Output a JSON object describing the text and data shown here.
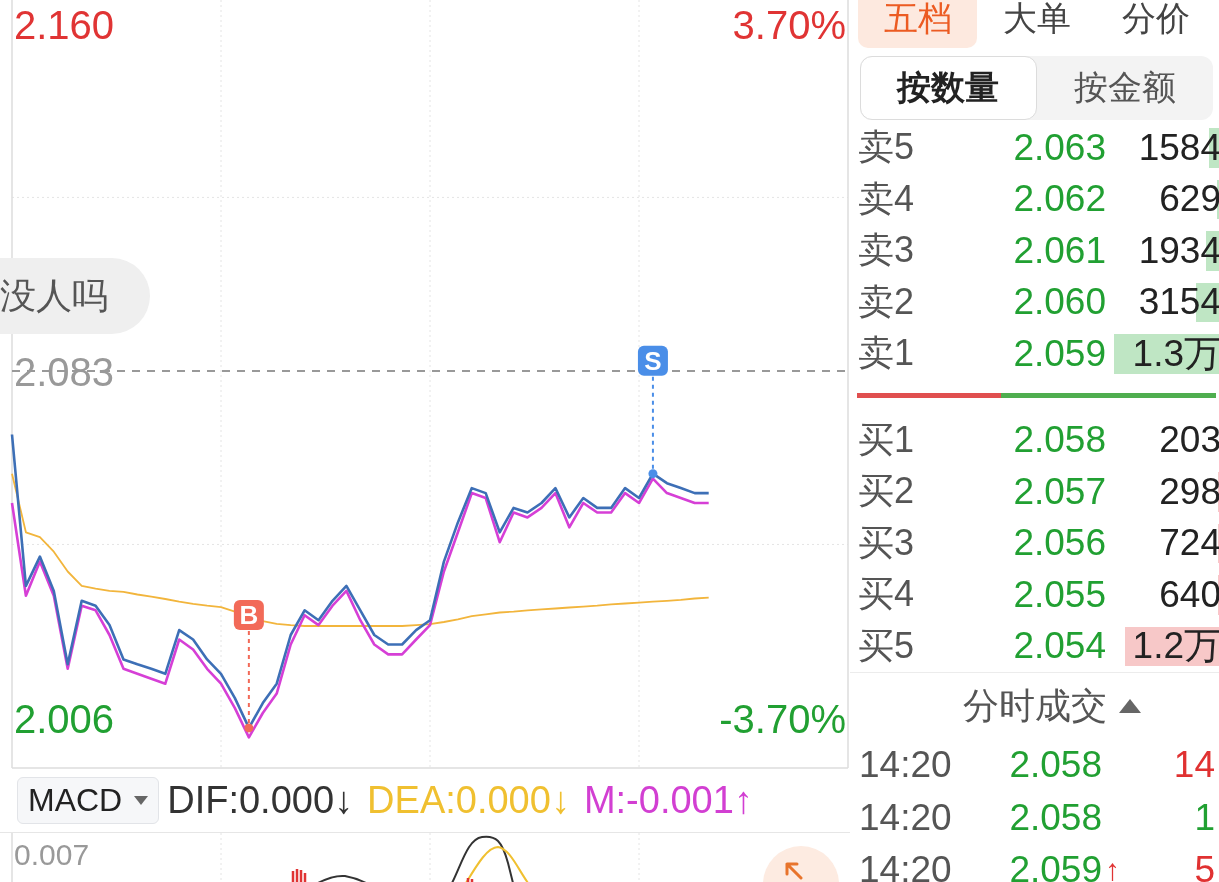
{
  "chart": {
    "comment_bubble": "没人吗",
    "chart_data": {
      "type": "line",
      "ylim": [
        1.9949,
        2.1653
      ],
      "yticks": [
        {
          "value": 2.16,
          "label": "2.160"
        },
        {
          "value": 2.083,
          "label": "2.083"
        },
        {
          "value": 2.006,
          "label": "2.006"
        }
      ],
      "y2lim": [
        -4.233,
        3.956
      ],
      "y2ticks": [
        {
          "value": 3.7,
          "label": "3.70%"
        },
        {
          "value": -3.7,
          "label": "-3.70%"
        }
      ],
      "grid": true,
      "ref_lines": [
        {
          "axis": "y",
          "value": 2.083,
          "color": "#999999",
          "line_style": "dashed"
        }
      ],
      "series": [
        {
          "color": "#3d6fb6",
          "values": [
            2.0689,
            2.0353,
            2.0418,
            2.0342,
            2.0179,
            2.032,
            2.0309,
            2.0266,
            2.019,
            2.0179,
            2.0169,
            2.0158,
            2.0255,
            2.0234,
            2.019,
            2.0158,
            2.0104,
            2.0038,
            2.0093,
            2.0136,
            2.0244,
            2.0299,
            2.0277,
            2.032,
            2.0353,
            2.0299,
            2.0244,
            2.0223,
            2.0223,
            2.0255,
            2.0277,
            2.0407,
            2.0494,
            2.057,
            2.0559,
            2.0472,
            2.0526,
            2.0516,
            2.0537,
            2.057,
            2.0505,
            2.0548,
            2.0526,
            2.0526,
            2.057,
            2.0548,
            2.0602,
            2.0581,
            2.057,
            2.0559,
            2.0559,
            null,
            null,
            null,
            null,
            null,
            null,
            null,
            null,
            null,
            null
          ]
        },
        {
          "color": "#d63fd6",
          "values": [
            2.0537,
            2.0331,
            2.0407,
            2.0331,
            2.0169,
            2.0309,
            2.0299,
            2.0244,
            2.0169,
            2.0158,
            2.0147,
            2.0136,
            2.0234,
            2.0212,
            2.0169,
            2.0136,
            2.0082,
            2.0017,
            2.0071,
            2.0114,
            2.0223,
            2.0288,
            2.0266,
            2.0309,
            2.0342,
            2.0277,
            2.0223,
            2.0201,
            2.0201,
            2.0234,
            2.0266,
            2.0385,
            2.0472,
            2.0559,
            2.0548,
            2.045,
            2.0516,
            2.0505,
            2.0526,
            2.0559,
            2.0483,
            2.0537,
            2.0516,
            2.0516,
            2.0559,
            2.0537,
            2.0591,
            2.0559,
            2.0548,
            2.0537,
            2.0537,
            null,
            null,
            null,
            null,
            null,
            null,
            null,
            null,
            null,
            null
          ]
        },
        {
          "color": "#f2b53c",
          "values": [
            2.0602,
            2.0472,
            2.0461,
            2.0429,
            2.0385,
            2.0353,
            2.0347,
            2.0342,
            2.034,
            2.0334,
            2.0329,
            2.0324,
            2.0318,
            2.0313,
            2.0309,
            2.0306,
            2.0296,
            2.0286,
            2.0275,
            2.0269,
            2.0266,
            2.0264,
            2.0264,
            2.0264,
            2.0264,
            2.0264,
            2.0264,
            2.0264,
            2.0264,
            2.0266,
            2.0268,
            2.0273,
            2.0279,
            2.0286,
            2.029,
            2.0294,
            2.0296,
            2.0299,
            2.0301,
            2.0303,
            2.0305,
            2.0307,
            2.0309,
            2.0312,
            2.0314,
            2.0316,
            2.0318,
            2.032,
            2.0322,
            2.0325,
            2.0327,
            null,
            null,
            null,
            null,
            null,
            null,
            null,
            null,
            null,
            null
          ]
        },
        {
          "name": "B",
          "type": "scatter",
          "color": "#f26a58",
          "values": [
            null,
            null,
            null,
            null,
            null,
            null,
            null,
            null,
            null,
            null,
            null,
            null,
            null,
            null,
            null,
            null,
            null,
            2.0038,
            null,
            null,
            null,
            null,
            null,
            null,
            null,
            null,
            null,
            null,
            null,
            null,
            null,
            null,
            null,
            null,
            null,
            null,
            null,
            null,
            null,
            null,
            null,
            null,
            null,
            null,
            null,
            null,
            null,
            null,
            null,
            null,
            null,
            null,
            null,
            null,
            null,
            null,
            null,
            null,
            null,
            null,
            null
          ]
        },
        {
          "name": "S",
          "type": "scatter",
          "color": "#4a8ee8",
          "values": [
            null,
            null,
            null,
            null,
            null,
            null,
            null,
            null,
            null,
            null,
            null,
            null,
            null,
            null,
            null,
            null,
            null,
            null,
            null,
            null,
            null,
            null,
            null,
            null,
            null,
            null,
            null,
            null,
            null,
            null,
            null,
            null,
            null,
            null,
            null,
            null,
            null,
            null,
            null,
            null,
            null,
            null,
            null,
            null,
            null,
            null,
            2.0602,
            null,
            null,
            null,
            null,
            null,
            null,
            null,
            null,
            null,
            null,
            null,
            null,
            null,
            null
          ]
        }
      ]
    }
  },
  "indicator_bar": {
    "selector": "MACD",
    "readings": [
      {
        "text": "DIF:0.000↓",
        "color": "#333333"
      },
      {
        "text": "DEA:0.000↓",
        "color": "#f0c030"
      },
      {
        "text": "M:-0.001↑",
        "color": "#d23fd2"
      }
    ]
  },
  "indicator_chart": {
    "axis_label": "0.007"
  },
  "tabs": [
    {
      "label": "五档",
      "selected": true
    },
    {
      "label": "大单",
      "selected": false
    },
    {
      "label": "分价",
      "selected": false
    }
  ],
  "unit_toggle": [
    {
      "label": "按数量",
      "selected": true
    },
    {
      "label": "按金额",
      "selected": false
    }
  ],
  "asks": [
    {
      "label": "卖5",
      "price": "2.063",
      "volume": "1584",
      "level": 0.11
    },
    {
      "label": "卖4",
      "price": "2.062",
      "volume": "629",
      "level": 0.04
    },
    {
      "label": "卖3",
      "price": "2.061",
      "volume": "1934",
      "level": 0.14
    },
    {
      "label": "卖2",
      "price": "2.060",
      "volume": "3154",
      "level": 0.23
    },
    {
      "label": "卖1",
      "price": "2.059",
      "volume": "1.3万",
      "level": 0.97
    }
  ],
  "balance": {
    "level": 0.4
  },
  "bids": [
    {
      "label": "买1",
      "price": "2.058",
      "volume": "203",
      "level": 0.02
    },
    {
      "label": "买2",
      "price": "2.057",
      "volume": "298",
      "level": 0.03
    },
    {
      "label": "买3",
      "price": "2.056",
      "volume": "724",
      "level": 0.03
    },
    {
      "label": "买4",
      "price": "2.055",
      "volume": "640",
      "level": 0.03
    },
    {
      "label": "买5",
      "price": "2.054",
      "volume": "1.2万",
      "level": 0.87
    }
  ],
  "trades": {
    "title": "分时成交",
    "rows": [
      {
        "time": "14:20",
        "price": "2.058",
        "volume": "14",
        "color": "#e03131"
      },
      {
        "time": "14:20",
        "price": "2.058",
        "volume": "1",
        "color": "#21a032"
      },
      {
        "time": "14:20",
        "price": "2.059",
        "arrow": "↑",
        "volume": "5",
        "color": "#e03131"
      }
    ]
  }
}
